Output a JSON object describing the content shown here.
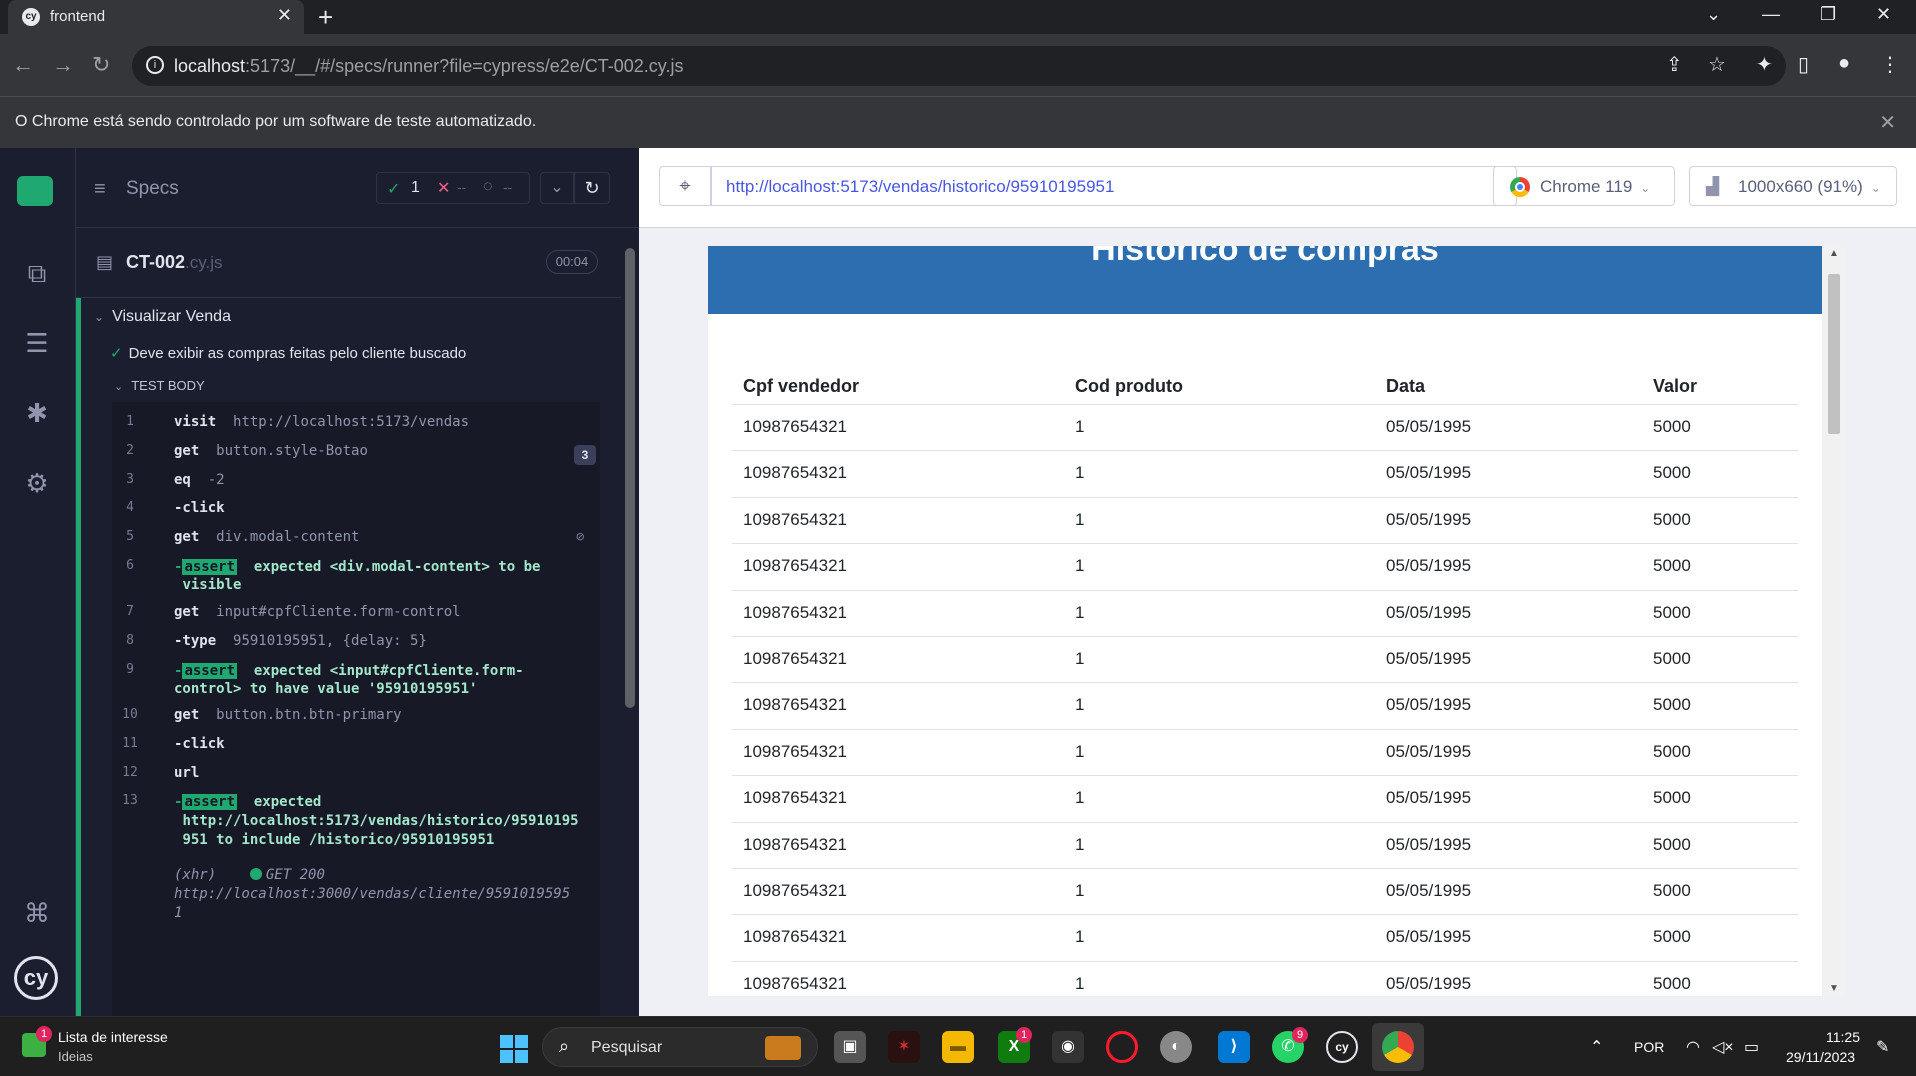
{
  "browser": {
    "tab_title": "frontend",
    "url_host": "localhost",
    "url_rest": ":5173/__/#/specs/runner?file=cypress/e2e/CT-002.cy.js",
    "infobar_message": "O Chrome está sendo controlado por um software de teste automatizado."
  },
  "reporter": {
    "specs_label": "Specs",
    "passed": "1",
    "failed": "--",
    "pending": "--",
    "spec_name": "CT-002",
    "spec_ext": ".cy.js",
    "duration": "00:04",
    "suite_title": "Visualizar Venda",
    "test_title": "Deve exibir as compras feitas pelo cliente buscado",
    "test_body_label": "TEST BODY",
    "commands": [
      {
        "num": "1",
        "name": "visit",
        "arg": "http://localhost:5173/vendas"
      },
      {
        "num": "2",
        "name": "get",
        "arg": "button.style-Botao",
        "count": "3"
      },
      {
        "num": "3",
        "name": "eq",
        "arg": "-2"
      },
      {
        "num": "4",
        "name": "-click",
        "arg": ""
      },
      {
        "num": "5",
        "name": "get",
        "arg": "div.modal-content"
      },
      {
        "num": "6",
        "name": "-assert",
        "badge": "assert",
        "line1": "expected <div.modal-content> to be",
        "line2": "visible"
      },
      {
        "num": "7",
        "name": "get",
        "arg": "input#cpfCliente.form-control"
      },
      {
        "num": "8",
        "name": "-type",
        "arg": "95910195951, {delay: 5}"
      },
      {
        "num": "9",
        "name": "-assert",
        "badge": "assert",
        "line1": "expected <input#cpfCliente.form-",
        "line2": "control> to have value '95910195951'"
      },
      {
        "num": "10",
        "name": "get",
        "arg": "button.btn.btn-primary"
      },
      {
        "num": "11",
        "name": "-click",
        "arg": ""
      },
      {
        "num": "12",
        "name": "url",
        "arg": ""
      },
      {
        "num": "13",
        "name": "-assert",
        "badge": "assert",
        "line1": "expected",
        "line2": "http://localhost:5173/vendas/historico/95910195",
        "line3": "951 to include /historico/95910195951"
      }
    ],
    "xhr": {
      "label": "(xhr)",
      "status": "GET 200",
      "url1": "http://localhost:3000/vendas/cliente/9591019595",
      "url2": "1"
    }
  },
  "aut": {
    "url": "http://localhost:5173/vendas/historico/95910195951",
    "browser_label": "Chrome 119",
    "viewport_label": "1000x660 (91%)"
  },
  "app": {
    "title": "Historico de compras",
    "columns": [
      "Cpf vendedor",
      "Cod produto",
      "Data",
      "Valor"
    ],
    "rows": [
      [
        "10987654321",
        "1",
        "05/05/1995",
        "5000"
      ],
      [
        "10987654321",
        "1",
        "05/05/1995",
        "5000"
      ],
      [
        "10987654321",
        "1",
        "05/05/1995",
        "5000"
      ],
      [
        "10987654321",
        "1",
        "05/05/1995",
        "5000"
      ],
      [
        "10987654321",
        "1",
        "05/05/1995",
        "5000"
      ],
      [
        "10987654321",
        "1",
        "05/05/1995",
        "5000"
      ],
      [
        "10987654321",
        "1",
        "05/05/1995",
        "5000"
      ],
      [
        "10987654321",
        "1",
        "05/05/1995",
        "5000"
      ],
      [
        "10987654321",
        "1",
        "05/05/1995",
        "5000"
      ],
      [
        "10987654321",
        "1",
        "05/05/1995",
        "5000"
      ],
      [
        "10987654321",
        "1",
        "05/05/1995",
        "5000"
      ],
      [
        "10987654321",
        "1",
        "05/05/1995",
        "5000"
      ],
      [
        "10987654321",
        "1",
        "05/05/1995",
        "5000"
      ]
    ]
  },
  "taskbar": {
    "widget_title": "Lista de interesse",
    "widget_subtitle": "Ideias",
    "widget_badge": "1",
    "search_placeholder": "Pesquisar",
    "xbox_badge": "1",
    "whatsapp_badge": "9",
    "language": "POR",
    "time": "11:25",
    "date": "29/11/2023"
  },
  "colors": {
    "cypress_green": "#1fa971",
    "app_banner": "#2c6eaf",
    "aut_url": "#4956e3"
  }
}
